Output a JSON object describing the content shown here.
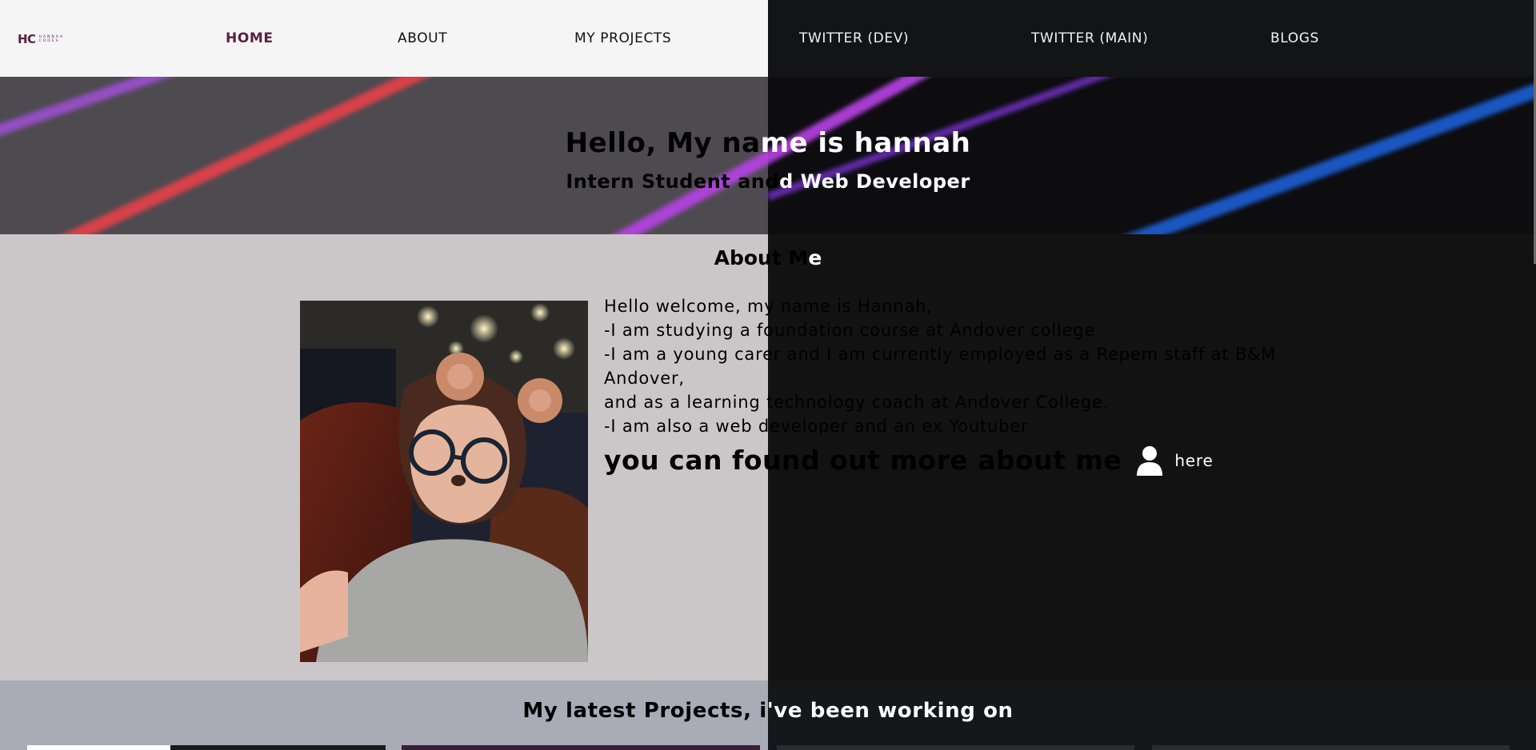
{
  "header": {
    "logo": {
      "mark": "HC",
      "word1": "HANNAH",
      "word2": "CODES"
    },
    "nav": [
      {
        "label": "HOME"
      },
      {
        "label": "ABOUT"
      },
      {
        "label": "MY PROJECTS"
      },
      {
        "label": "TWITTER (DEV)"
      },
      {
        "label": "TWITTER (MAIN)"
      },
      {
        "label": "BLOGS"
      }
    ]
  },
  "hero": {
    "title_left": "Hello, My na",
    "title_right": "me is hannah",
    "subtitle_left": "Intern Student and",
    "subtitle_right": "d Web Developer"
  },
  "about": {
    "heading_left": "About M",
    "heading_right": "e",
    "lines": [
      "Hello welcome, my name is Hannah,",
      "-I am studying a foundation course at Andover college",
      "-I am a young carer and I am currently employed as a Repem staff at B&M",
      "Andover,",
      "and as a learning technology coach at Andover College.",
      "-I am also a web developer and an ex Youtuber"
    ],
    "more_text": "you can found out more about me",
    "here_label": "here",
    "person_icon": "person-icon"
  },
  "projects": {
    "heading_left": "My latest Projects, i",
    "heading_right": "'ve been working on"
  },
  "colors": {
    "brand": "#5a1f3e",
    "dark_bg": "#121212",
    "light_bg": "#cbc7c8"
  }
}
